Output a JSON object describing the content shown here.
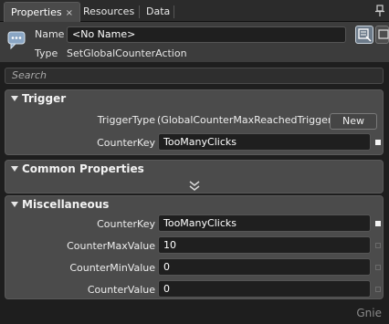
{
  "tabs": [
    {
      "label": "Properties",
      "close": "×",
      "active": true
    },
    {
      "label": "Resources",
      "active": false
    },
    {
      "label": "Data",
      "active": false
    }
  ],
  "header": {
    "name_label": "Name",
    "name_value": "<No Name>",
    "type_label": "Type",
    "type_value": "SetGlobalCounterAction"
  },
  "search": {
    "placeholder": "Search"
  },
  "sections": {
    "trigger": {
      "title": "Trigger",
      "trigger_type_label": "TriggerType",
      "trigger_type_value": "(GlobalCounterMaxReachedTrigger)",
      "new_button": "New",
      "counter_key_label": "CounterKey",
      "counter_key_value": "TooManyClicks"
    },
    "common": {
      "title": "Common Properties"
    },
    "misc": {
      "title": "Miscellaneous",
      "rows": [
        {
          "label": "CounterKey",
          "value": "TooManyClicks"
        },
        {
          "label": "CounterMaxValue",
          "value": "10"
        },
        {
          "label": "CounterMinValue",
          "value": "0"
        },
        {
          "label": "CounterValue",
          "value": "0"
        }
      ]
    }
  },
  "watermark": "Gnie",
  "colors": {
    "panel": "#4b4b4b",
    "input_bg": "#1f1f1f",
    "tab_active": "#4a4a4a"
  }
}
